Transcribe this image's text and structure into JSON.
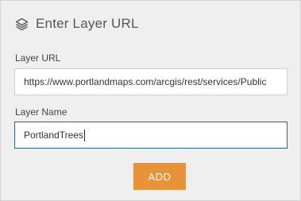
{
  "header": {
    "icon": "layers-icon",
    "title": "Enter Layer URL"
  },
  "url_field": {
    "label": "Layer URL",
    "value": "https://www.portlandmaps.com/arcgis/rest/services/Public"
  },
  "name_field": {
    "label": "Layer Name",
    "value": "PortlandTrees"
  },
  "add_button": {
    "label": "ADD"
  },
  "colors": {
    "panel_background": "#efefef",
    "accent": "#e8923a",
    "focus_border": "#2f5f99"
  }
}
